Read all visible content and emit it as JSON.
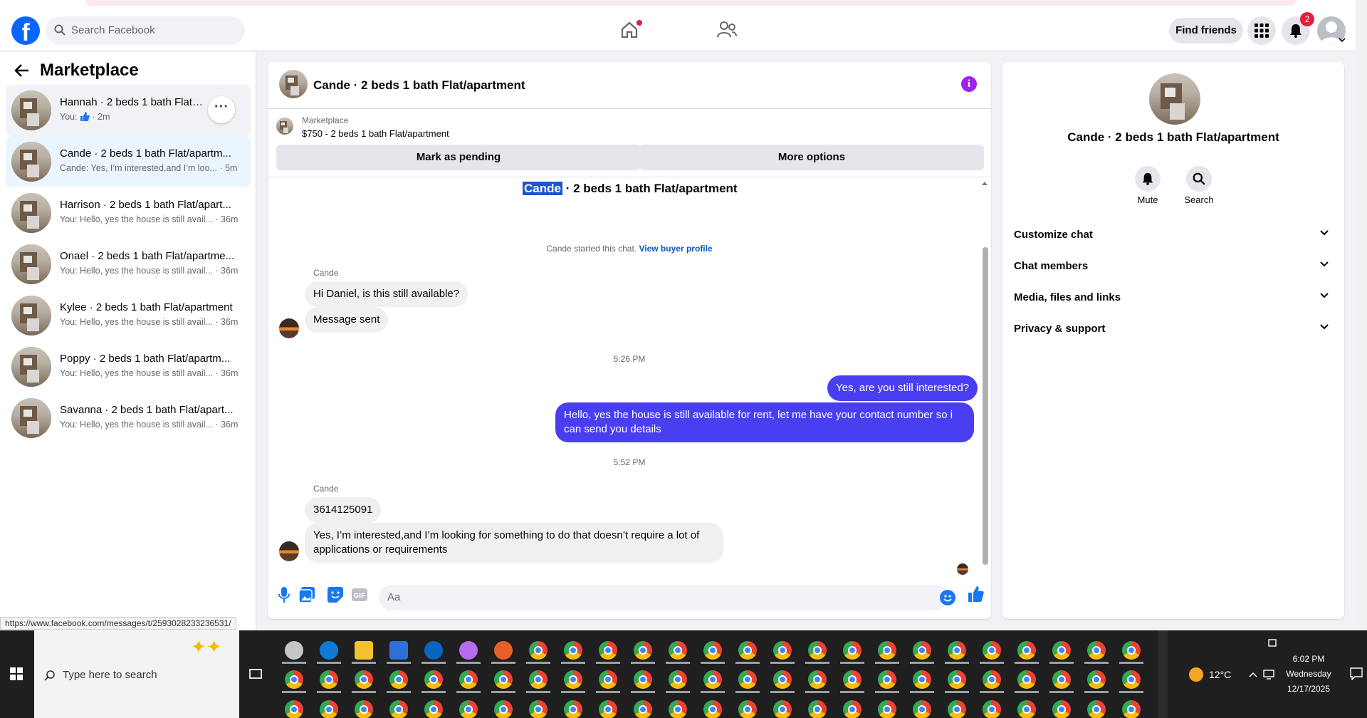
{
  "topbar": {
    "search_placeholder": "Search Facebook",
    "find_friends": "Find friends",
    "notif_count": "2"
  },
  "sidebar": {
    "title": "Marketplace",
    "conversations": [
      {
        "name": "Hannah · 2 beds 1 bath Flat/apartment",
        "preview_prefix": "You:",
        "preview_suffix": "· 2m",
        "has_like": true
      },
      {
        "name": "Cande · 2 beds 1 bath Flat/apartm...",
        "preview": "Cande: Yes, I’m interested,and I’m loo...",
        "time": "· 5m"
      },
      {
        "name": "Harrison · 2 beds 1 bath Flat/apart...",
        "preview": "You: Hello, yes the house is still avail...",
        "time": "· 36m"
      },
      {
        "name": "Onael · 2 beds 1 bath Flat/apartme...",
        "preview": "You: Hello, yes the house is still avail...",
        "time": "· 36m"
      },
      {
        "name": "Kylee · 2 beds 1 bath Flat/apartment",
        "preview": "You: Hello, yes the house is still avail...",
        "time": "· 36m"
      },
      {
        "name": "Poppy · 2 beds 1 bath Flat/apartm...",
        "preview": "You: Hello, yes the house is still avail...",
        "time": "· 36m"
      },
      {
        "name": "Savanna · 2 beds 1 bath Flat/apart...",
        "preview": "You: Hello, yes the house is still avail...",
        "time": "· 36m"
      }
    ]
  },
  "chat": {
    "title": "Cande · 2 beds 1 bath Flat/apartment",
    "marketplace_label": "Marketplace",
    "listing": "$750 - 2 beds 1 bath Flat/apartment",
    "mark_pending": "Mark as pending",
    "more_options": "More options",
    "conv_title_selected": "Cande",
    "conv_title_rest": " · 2 beds 1 bath Flat/apartment",
    "started_text": "Cande started this chat.",
    "view_buyer": "View buyer profile",
    "sender_name": "Cande",
    "msg1": "Hi Daniel, is this still available?",
    "msg2": "Message sent",
    "time1": "5:26 PM",
    "out1": "Yes, are you still interested?",
    "out2": "Hello, yes the house is still available for rent, let me have your contact number so i can send you details",
    "time2": "5:52 PM",
    "msg3": "3614125091",
    "msg4": "Yes, I’m interested,and I’m looking for something to do that doesn’t require a lot of applications or requirements",
    "composer_placeholder": "Aa"
  },
  "right": {
    "title": "Cande · 2 beds 1 bath Flat/apartment",
    "mute": "Mute",
    "search": "Search",
    "items": [
      "Customize chat",
      "Chat members",
      "Media, files and links",
      "Privacy & support"
    ]
  },
  "status_url": "https://www.facebook.com/messages/t/25930282332365​31/",
  "taskbar": {
    "search_placeholder": "Type here to search",
    "temp": "12°C",
    "time": "6:02 PM",
    "day": "Wednesday",
    "date": "12/17/2025"
  }
}
